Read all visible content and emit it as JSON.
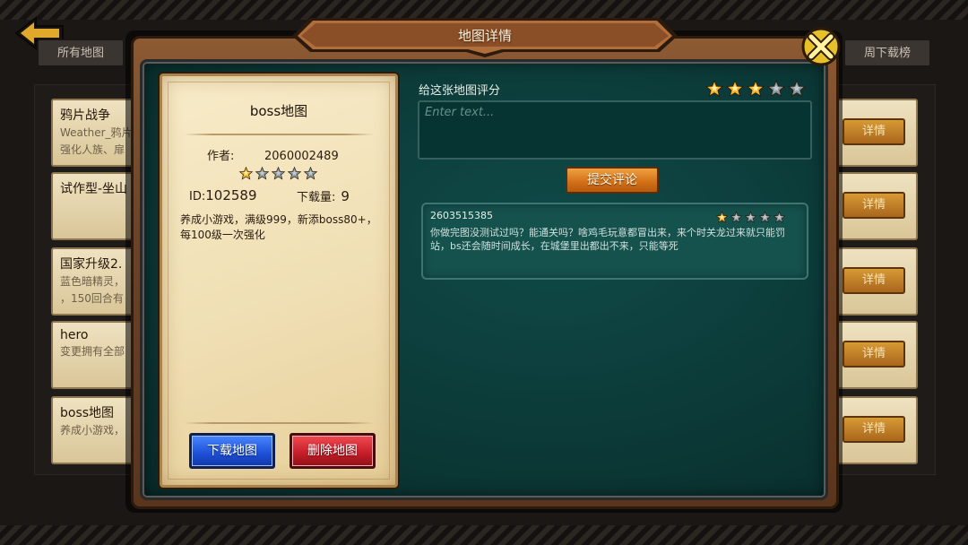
{
  "background": {
    "tab_all": "所有地图",
    "tab_weekly": "周下载榜",
    "list": [
      {
        "title": "鸦片战争",
        "desc_line1": "Weather_鸦片",
        "desc_line2": "强化人族、扉"
      },
      {
        "title": "试作型-坐山",
        "desc_line1": "",
        "desc_line2": ""
      },
      {
        "title": "国家升级2.",
        "desc_line1": "蓝色暗精灵，",
        "desc_line2": "，150回合有"
      },
      {
        "title": "hero",
        "desc_line1": "变更拥有全部",
        "desc_line2": ""
      },
      {
        "title": "boss地图",
        "desc_line1": "养成小游戏，",
        "desc_line2": ""
      }
    ],
    "detail_label": "详情"
  },
  "dialog": {
    "title": "地图详情",
    "map": {
      "name": "boss地图",
      "author_label": "作者:",
      "author_value": "2060002489",
      "rating": 1,
      "rating_max": 5,
      "id_label": "ID:",
      "id_value": "102589",
      "downloads_label": "下载量:",
      "downloads_value": "9",
      "description": "养成小游戏，满级999，新添boss80+，每100级一次强化",
      "download_button": "下载地图",
      "delete_button": "删除地图"
    },
    "rating_section": {
      "label": "给这张地图评分",
      "selected_rating": 3,
      "rating_max": 5,
      "input_placeholder": "Enter text...",
      "input_value": "",
      "submit_button": "提交评论"
    },
    "comments": [
      {
        "user": "2603515385",
        "rating": 1,
        "rating_max": 5,
        "text": "你做完图没测试过吗？能通关吗？啥鸡毛玩意都冒出来，来个时关龙过来就只能罚站，bs还会随时间成长，在城堡里出都出不来，只能等死"
      }
    ]
  },
  "colors": {
    "teal_panel": "#0b3836",
    "parchment": "#f0dfb4",
    "star_gold": "#f5b52a",
    "star_empty": "#8a9aa0",
    "download_blue": "#1c4fd6",
    "delete_red": "#c51c27",
    "submit_orange": "#d16f16"
  },
  "icons": {
    "back": "back-arrow-icon",
    "close": "close-x-icon",
    "star_filled": "star-filled-icon",
    "star_empty": "star-empty-icon"
  }
}
